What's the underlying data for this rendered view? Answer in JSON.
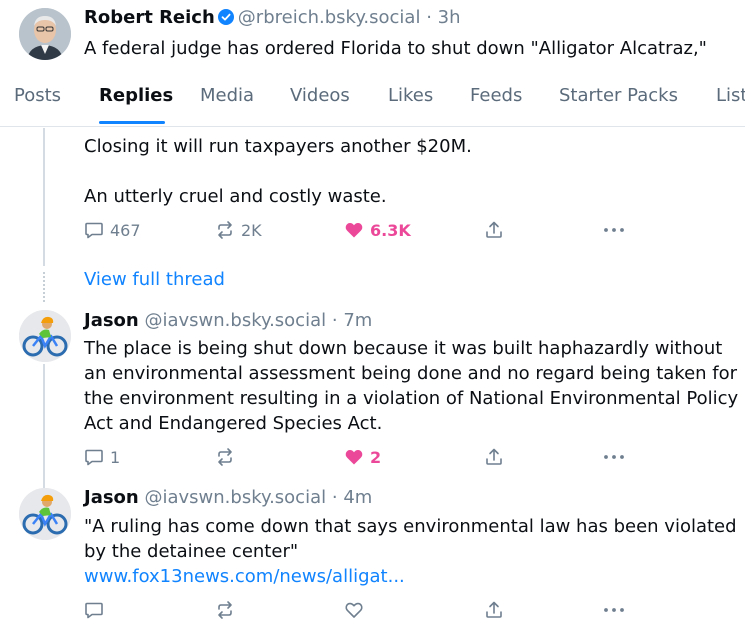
{
  "top_post": {
    "author_name": "Robert Reich",
    "handle": "@rbreich.bsky.social",
    "separator": "·",
    "time": "3h",
    "text": "A federal judge has ordered Florida to shut down \"Alligator Alcatraz,\""
  },
  "tabs": [
    {
      "label": "Posts",
      "active": false
    },
    {
      "label": "Replies",
      "active": true
    },
    {
      "label": "Media",
      "active": false
    },
    {
      "label": "Videos",
      "active": false
    },
    {
      "label": "Likes",
      "active": false
    },
    {
      "label": "Feeds",
      "active": false
    },
    {
      "label": "Starter Packs",
      "active": false
    },
    {
      "label": "Lists",
      "active": false
    }
  ],
  "parent_post": {
    "text_line1": "Closing it will run taxpayers another $20M.",
    "text_line2": "An utterly cruel and costly waste.",
    "replies": "467",
    "reposts": "2K",
    "likes": "6.3K",
    "liked": true
  },
  "view_full_thread": "View full thread",
  "replies": [
    {
      "author_name": "Jason",
      "handle": "@iavswn.bsky.social",
      "separator": "·",
      "time": "7m",
      "text_lines": [
        "The place is being shut down because it was built haphazardly without",
        "an environmental assessment being done and no regard being taken for",
        "the environment resulting in a violation of  National Environmental Policy",
        "Act  and Endangered Species Act."
      ],
      "replies": "1",
      "reposts": "",
      "likes": "2",
      "liked": true
    },
    {
      "author_name": "Jason",
      "handle": "@iavswn.bsky.social",
      "separator": "·",
      "time": "4m",
      "text_lines": [
        "\"A ruling has come down that says environmental law has been violated",
        "by the detainee center\""
      ],
      "link": "www.fox13news.com/news/alligat...",
      "replies": "",
      "reposts": "",
      "likes": "",
      "liked": false
    }
  ],
  "colors": {
    "accent": "#1083fe",
    "like": "#ec4899",
    "muted": "#6f7f8f",
    "text": "#0b0f14"
  },
  "icons": [
    "reply-icon",
    "repost-icon",
    "heart-icon",
    "share-icon",
    "more-icon",
    "verified-badge-icon"
  ]
}
